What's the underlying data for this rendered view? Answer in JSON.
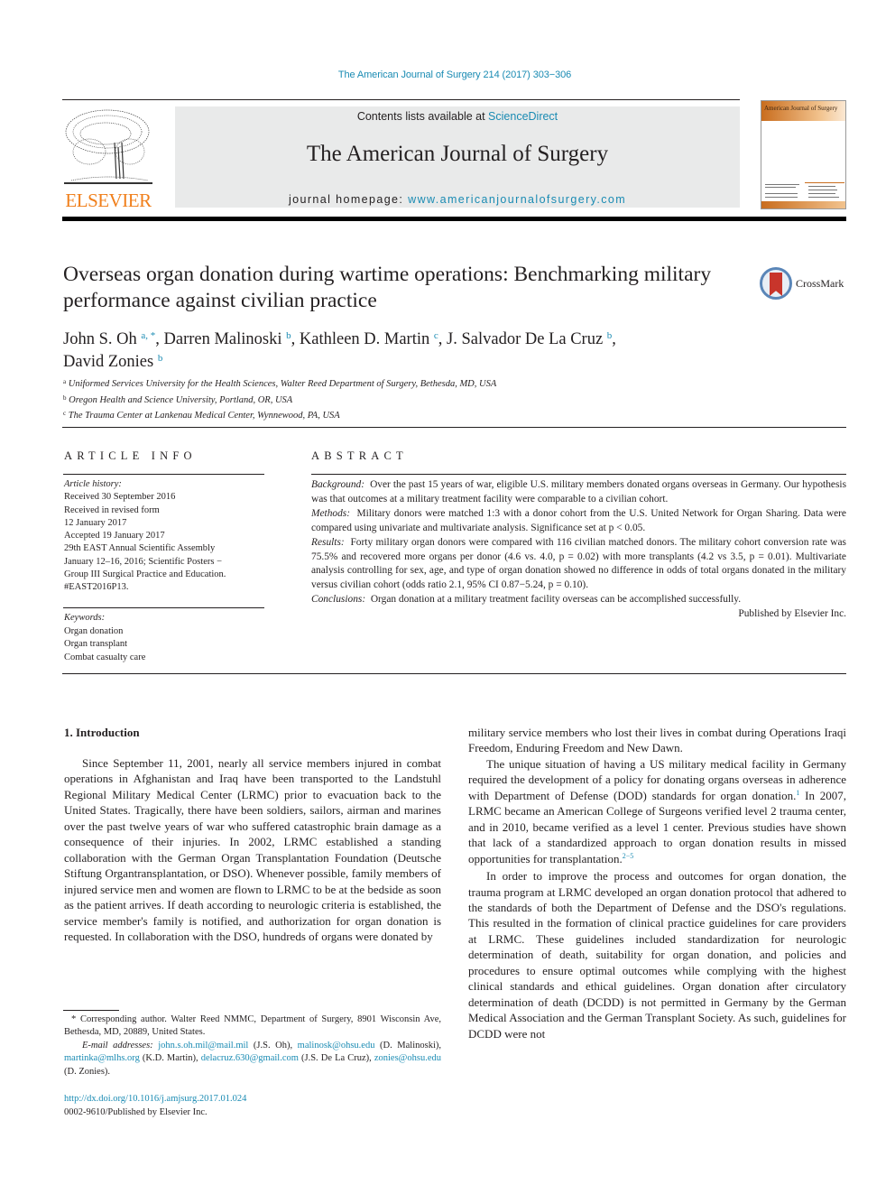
{
  "journal_ref": "The American Journal of Surgery 214 (2017) 303−306",
  "publisher": {
    "logo_text": "ELSEVIER",
    "logo_color": "#f07f1b"
  },
  "banner": {
    "contents_prefix": "Contents lists available at ",
    "contents_link": "ScienceDirect",
    "journal_name": "The American Journal of Surgery",
    "homepage_prefix": "journal homepage: ",
    "homepage_link": "www.americanjournalofsurgery.com"
  },
  "cover": {
    "title": "American Journal of Surgery"
  },
  "link_color": "#1a8bb3",
  "article": {
    "title": "Overseas organ donation during wartime operations: Benchmarking military performance against civilian practice",
    "crossmark_label": "CrossMark",
    "authors": [
      {
        "name": "John S. Oh",
        "sup": "a, *",
        "sep": ", "
      },
      {
        "name": "Darren Malinoski",
        "sup": "b",
        "sep": ", "
      },
      {
        "name": "Kathleen D. Martin",
        "sup": "c",
        "sep": ", "
      },
      {
        "name": "J. Salvador De La Cruz",
        "sup": "b",
        "sep": ","
      },
      {
        "name": "David Zonies",
        "sup": "b",
        "sep": ""
      }
    ],
    "affiliations": [
      {
        "key": "a",
        "text": "Uniformed Services University for the Health Sciences, Walter Reed Department of Surgery, Bethesda, MD, USA"
      },
      {
        "key": "b",
        "text": "Oregon Health and Science University, Portland, OR, USA"
      },
      {
        "key": "c",
        "text": "The Trauma Center at Lankenau Medical Center, Wynnewood, PA, USA"
      }
    ]
  },
  "article_info": {
    "heading": "ARTICLE INFO",
    "history_label": "Article history:",
    "history": [
      "Received 30 September 2016",
      "Received in revised form",
      "12 January 2017",
      "Accepted 19 January 2017",
      "29th EAST Annual Scientific Assembly",
      "January 12‒16, 2016; Scientific Posters −",
      "Group III Surgical Practice and Education.",
      "#EAST2016P13."
    ],
    "keywords_label": "Keywords:",
    "keywords": [
      "Organ donation",
      "Organ transplant",
      "Combat casualty care"
    ]
  },
  "abstract": {
    "heading": "ABSTRACT",
    "sections": [
      {
        "label": "Background:",
        "text": "Over the past 15 years of war, eligible U.S. military members donated organs overseas in Germany. Our hypothesis was that outcomes at a military treatment facility were comparable to a civilian cohort."
      },
      {
        "label": "Methods:",
        "text": "Military donors were matched 1:3 with a donor cohort from the U.S. United Network for Organ Sharing. Data were compared using univariate and multivariate analysis. Significance set at p < 0.05."
      },
      {
        "label": "Results:",
        "text": "Forty military organ donors were compared with 116 civilian matched donors. The military cohort conversion rate was 75.5% and recovered more organs per donor (4.6 vs. 4.0, p = 0.02) with more transplants (4.2 vs 3.5, p = 0.01). Multivariate analysis controlling for sex, age, and type of organ donation showed no difference in odds of total organs donated in the military versus civilian cohort (odds ratio 2.1, 95% CI 0.87−5.24, p = 0.10)."
      },
      {
        "label": "Conclusions:",
        "text": "Organ donation at a military treatment facility overseas can be accomplished successfully."
      }
    ],
    "published_by": "Published by Elsevier Inc."
  },
  "body": {
    "section_heading": "1.  Introduction",
    "left_paragraph": "Since September 11, 2001, nearly all service members injured in combat operations in Afghanistan and Iraq have been transported to the Landstuhl Regional Military Medical Center (LRMC) prior to evacuation back to the United States. Tragically, there have been soldiers, sailors, airman and marines over the past twelve years of war who suffered catastrophic brain damage as a consequence of their injuries. In 2002, LRMC established a standing collaboration with the German Organ Transplantation Foundation (Deutsche Stiftung Organtransplantation, or DSO). Whenever possible, family members of injured service men and women are flown to LRMC to be at the bedside as soon as the patient arrives. If death according to neurologic criteria is established, the service member's family is notified, and authorization for organ donation is requested. In collaboration with the DSO, hundreds of organs were donated by",
    "right_p1": "military service members who lost their lives in combat during Operations Iraqi Freedom, Enduring Freedom and New Dawn.",
    "right_p2_a": "The unique situation of having a US military medical facility in Germany required the development of a policy for donating organs overseas in adherence with Department of Defense (DOD) standards for organ donation.",
    "right_p2_ref1": "1",
    "right_p2_b": " In 2007, LRMC became an American College of Surgeons verified level 2 trauma center, and in 2010, became verified as a level 1 center. Previous studies have shown that lack of a standardized approach to organ donation results in missed opportunities for transplantation.",
    "right_p2_ref2": "2−5",
    "right_p3": "In order to improve the process and outcomes for organ donation, the trauma program at LRMC developed an organ donation protocol that adhered to the standards of both the Department of Defense and the DSO's regulations. This resulted in the formation of clinical practice guidelines for care providers at LRMC. These guidelines included standardization for neurologic determination of death, suitability for organ donation, and policies and procedures to ensure optimal outcomes while complying with the highest clinical standards and ethical guidelines. Organ donation after circulatory determination of death (DCDD) is not permitted in Germany by the German Medical Association and the German Transplant Society. As such, guidelines for DCDD were not"
  },
  "footnotes": {
    "corresponding": "* Corresponding author. Walter Reed NMMC, Department of Surgery, 8901 Wisconsin Ave, Bethesda, MD, 20889, United States.",
    "email_label": "E-mail addresses:",
    "emails": [
      {
        "address": "john.s.oh.mil@mail.mil",
        "who": " (J.S. Oh), "
      },
      {
        "address": "malinosk@ohsu.edu",
        "who": " (D. Malinoski), "
      },
      {
        "address": "martinka@mlhs.org",
        "who": " (K.D. Martin), "
      },
      {
        "address": "delacruz.630@gmail.com",
        "who": " (J.S. De La Cruz), "
      },
      {
        "address": "zonies@ohsu.edu",
        "who": " (D. Zonies)."
      }
    ],
    "doi": "http://dx.doi.org/10.1016/j.amjsurg.2017.01.024",
    "issn_line": "0002-9610/Published by Elsevier Inc."
  }
}
